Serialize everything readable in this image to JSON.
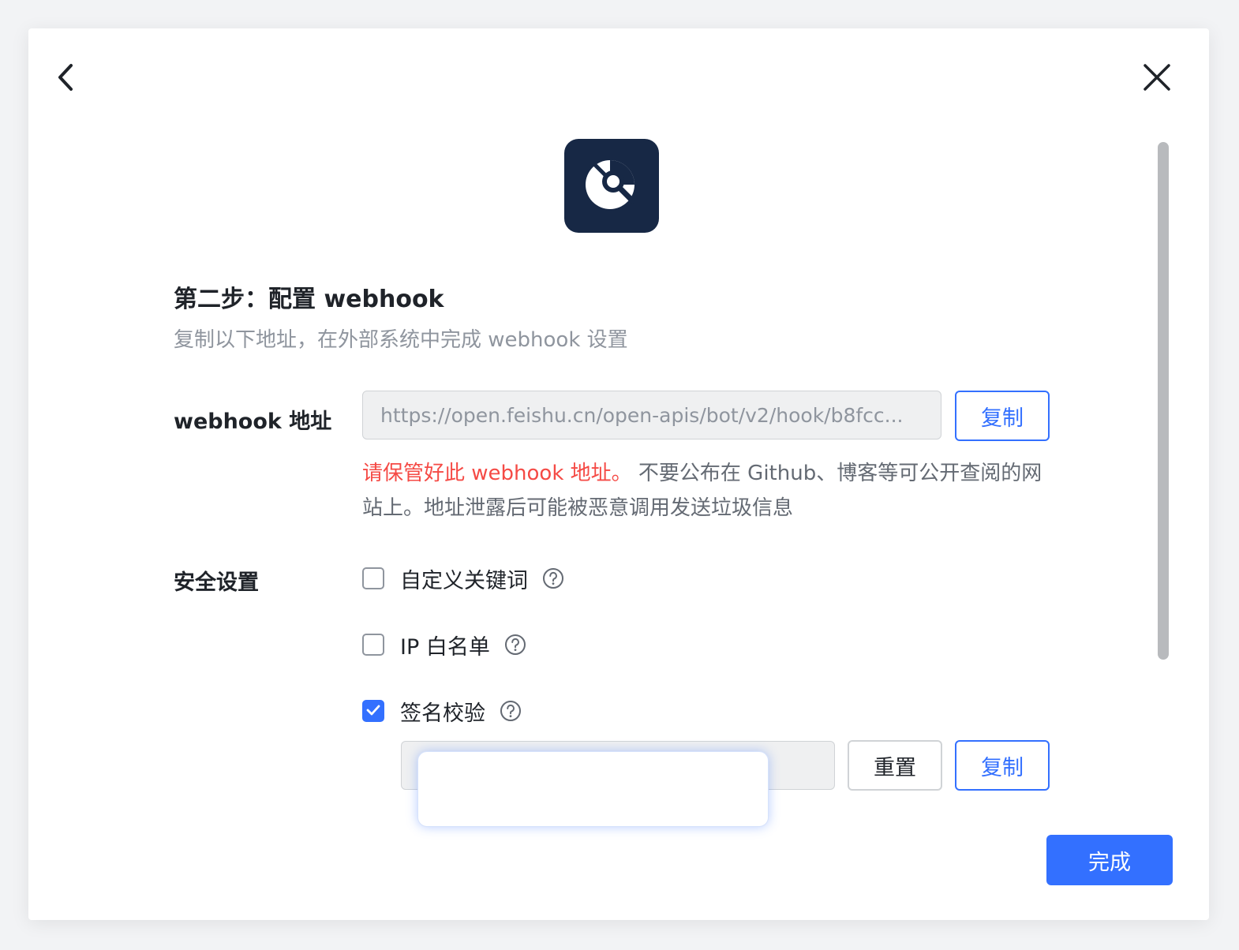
{
  "dialog": {
    "step_title": "第二步：配置 webhook",
    "step_subtitle": "复制以下地址，在外部系统中完成 webhook 设置",
    "logo_icon": "bot-search-logo-icon",
    "logo_bg_color": "#172845"
  },
  "webhook": {
    "label": "webhook 地址",
    "url_value": "https://open.feishu.cn/open-apis/bot/v2/hook/b8fcc...",
    "copy_label": "复制",
    "warning_red": "请保管好此 webhook 地址。",
    "warning_rest": " 不要公布在 Github、博客等可公开查阅的网站上。地址泄露后可能被恶意调用发送垃圾信息"
  },
  "security": {
    "label": "安全设置",
    "options": [
      {
        "label": "自定义关键词",
        "checked": false,
        "icon": "help-circle-icon"
      },
      {
        "label": "IP 白名单",
        "checked": false,
        "icon": "help-circle-icon"
      },
      {
        "label": "签名校验",
        "checked": true,
        "icon": "help-circle-icon"
      }
    ],
    "secret": {
      "value": "",
      "reset_label": "重置",
      "copy_label": "复制"
    }
  },
  "footer": {
    "done_label": "完成"
  },
  "colors": {
    "accent": "#3370ff",
    "warning": "#f54a45",
    "text_primary": "#1f2329",
    "text_secondary": "#8f959e"
  }
}
